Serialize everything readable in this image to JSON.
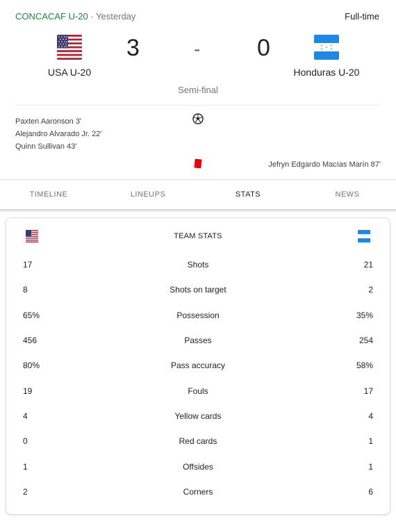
{
  "header": {
    "competition": "CONCACAF U-20",
    "separator": " · ",
    "when": "Yesterday",
    "status": "Full-time"
  },
  "match": {
    "home_team": "USA U-20",
    "away_team": "Honduras U-20",
    "home_score": "3",
    "dash": "-",
    "away_score": "0",
    "stage": "Semi-final"
  },
  "events": {
    "home_scorers": [
      "Paxten Aaronson 3'",
      "Alejandro Alvarado Jr. 22'",
      "Quinn Sullivan 43'"
    ],
    "away_red_card": "Jefryn Edgardo Macías Marín 87'",
    "goal_icon": "soccer-ball-icon",
    "red_card_icon": "red-card-icon",
    "red_card_color": "#e8000b"
  },
  "tabs": [
    {
      "label": "TIMELINE",
      "active": false
    },
    {
      "label": "LINEUPS",
      "active": false
    },
    {
      "label": "STATS",
      "active": true
    },
    {
      "label": "NEWS",
      "active": false
    }
  ],
  "team_stats": {
    "title": "TEAM STATS",
    "rows": [
      {
        "label": "Shots",
        "home": "17",
        "away": "21"
      },
      {
        "label": "Shots on target",
        "home": "8",
        "away": "2"
      },
      {
        "label": "Possession",
        "home": "65%",
        "away": "35%"
      },
      {
        "label": "Passes",
        "home": "456",
        "away": "254"
      },
      {
        "label": "Pass accuracy",
        "home": "80%",
        "away": "58%"
      },
      {
        "label": "Fouls",
        "home": "19",
        "away": "17"
      },
      {
        "label": "Yellow cards",
        "home": "4",
        "away": "4"
      },
      {
        "label": "Red cards",
        "home": "0",
        "away": "1"
      },
      {
        "label": "Offsides",
        "home": "1",
        "away": "1"
      },
      {
        "label": "Corners",
        "home": "2",
        "away": "6"
      }
    ]
  },
  "colors": {
    "competition": "#1a8b3c",
    "honduras_blue": "#1e88e5",
    "usa_red": "#b22234",
    "usa_blue": "#3c3b6e"
  }
}
